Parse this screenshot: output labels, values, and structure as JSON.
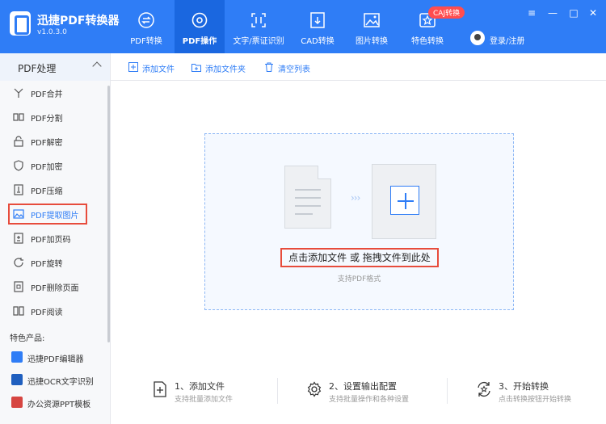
{
  "app": {
    "title": "迅捷PDF转换器",
    "version": "v1.0.3.0"
  },
  "colors": {
    "accent": "#2f7df6",
    "active_tab": "#1a67e0",
    "highlight": "#e74c3c",
    "badge": "#ff4d4f"
  },
  "nav": {
    "tabs": [
      {
        "label": "PDF转换",
        "icon": "convert-icon"
      },
      {
        "label": "PDF操作",
        "icon": "gear-icon",
        "active": true
      },
      {
        "label": "文字/票证识别",
        "icon": "scan-icon"
      },
      {
        "label": "CAD转换",
        "icon": "cad-icon"
      },
      {
        "label": "图片转换",
        "icon": "image-icon"
      },
      {
        "label": "特色转换",
        "icon": "star-icon"
      }
    ],
    "badge": "CAJ转换",
    "login": "登录/注册"
  },
  "window": {
    "minimize": "—",
    "maximize": "□",
    "close": "✕",
    "menu": "≡"
  },
  "sidebar": {
    "section": "PDF处理",
    "items": [
      {
        "label": "PDF合并",
        "icon": "merge-icon"
      },
      {
        "label": "PDF分割",
        "icon": "split-icon"
      },
      {
        "label": "PDF解密",
        "icon": "unlock-icon"
      },
      {
        "label": "PDF加密",
        "icon": "shield-icon"
      },
      {
        "label": "PDF压缩",
        "icon": "compress-icon"
      },
      {
        "label": "PDF提取图片",
        "icon": "image-icon",
        "active": true
      },
      {
        "label": "PDF加页码",
        "icon": "page-number-icon"
      },
      {
        "label": "PDF旋转",
        "icon": "rotate-icon"
      },
      {
        "label": "PDF删除页面",
        "icon": "delete-page-icon"
      },
      {
        "label": "PDF阅读",
        "icon": "book-icon"
      }
    ],
    "featured_title": "特色产品:",
    "featured": [
      {
        "label": "迅捷PDF编辑器",
        "icon": "pdf-editor-icon"
      },
      {
        "label": "迅捷OCR文字识别",
        "icon": "ocr-icon"
      },
      {
        "label": "办公资源PPT模板",
        "icon": "ppt-icon"
      }
    ]
  },
  "toolbar": {
    "add_file": "添加文件",
    "add_folder": "添加文件夹",
    "clear_list": "清空列表"
  },
  "drop": {
    "main": "点击添加文件 或 拖拽文件到此处",
    "sub": "支持PDF格式",
    "arrows": "›››"
  },
  "steps": [
    {
      "title": "1、添加文件",
      "desc": "支持批量添加文件",
      "icon": "add-file-icon"
    },
    {
      "title": "2、设置输出配置",
      "desc": "支持批量操作和各种设置",
      "icon": "settings-icon"
    },
    {
      "title": "3、开始转换",
      "desc": "点击转换按钮开始转换",
      "icon": "convert-start-icon"
    }
  ]
}
